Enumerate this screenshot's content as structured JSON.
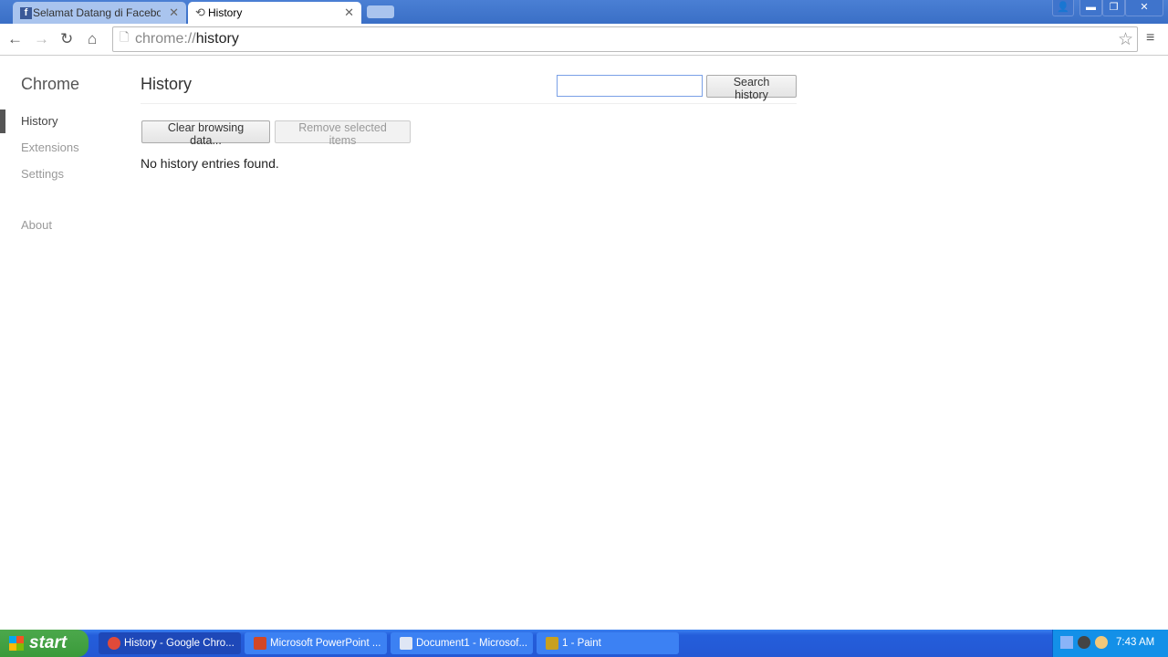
{
  "browser": {
    "tabs": [
      {
        "title": "Selamat Datang di Facebook",
        "icon": "facebook-icon",
        "active": false
      },
      {
        "title": "History",
        "icon": "history-icon",
        "active": true
      }
    ],
    "url_scheme": "chrome://",
    "url_path": "history"
  },
  "sidebar": {
    "brand": "Chrome",
    "items": [
      {
        "label": "History",
        "active": true
      },
      {
        "label": "Extensions"
      },
      {
        "label": "Settings"
      },
      {
        "label": "About"
      }
    ]
  },
  "main": {
    "title": "History",
    "search_value": "",
    "search_button": "Search history",
    "clear_button": "Clear browsing data...",
    "remove_button": "Remove selected items",
    "empty_message": "No history entries found."
  },
  "taskbar": {
    "start": "start",
    "items": [
      {
        "label": "History - Google Chro...",
        "active": true,
        "color": "#e04a3a"
      },
      {
        "label": "Microsoft PowerPoint ...",
        "color": "#d24726"
      },
      {
        "label": "Document1 - Microsof...",
        "color": "#2b5797"
      },
      {
        "label": "1 - Paint",
        "color": "#c8a020"
      }
    ],
    "clock": "7:43 AM"
  }
}
